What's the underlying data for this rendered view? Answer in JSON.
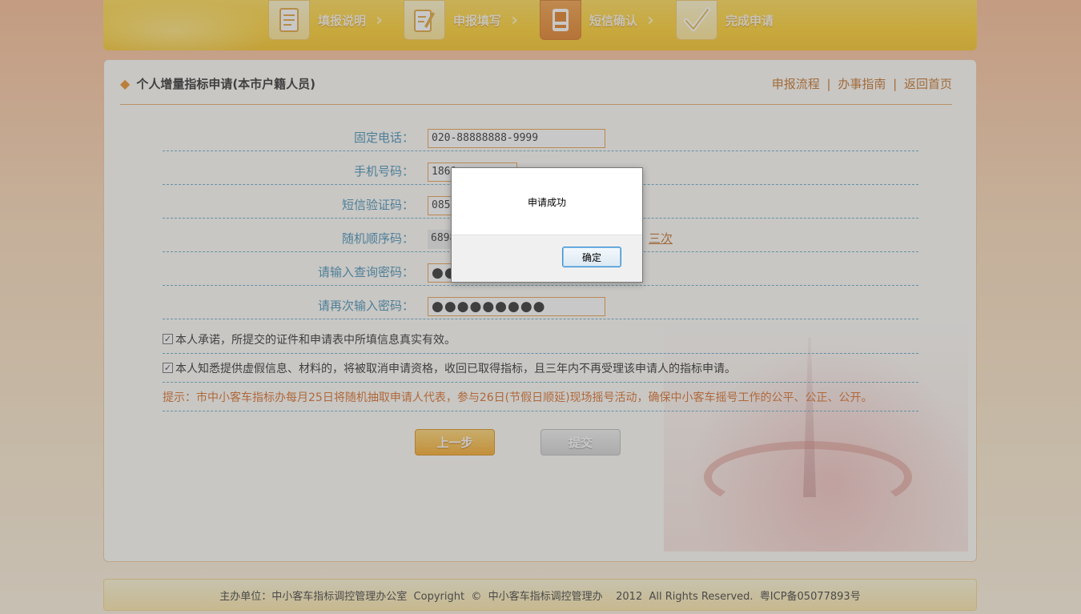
{
  "steps": [
    {
      "label": "填报说明",
      "icon": "document-icon"
    },
    {
      "label": "申报填写",
      "icon": "edit-icon"
    },
    {
      "label": "短信确认",
      "icon": "phone-icon"
    },
    {
      "label": "完成申请",
      "icon": "checkmark-icon"
    }
  ],
  "header": {
    "title": "个人增量指标申请(本市户籍人员)",
    "links": [
      "申报流程",
      "办事指南",
      "返回首页"
    ],
    "separator": "|"
  },
  "form": {
    "landline_label": "固定电话：",
    "landline_value": "020-88888888-9999",
    "mobile_label": "手机号码：",
    "mobile_value": "1860",
    "sms_code_label": "短信验证码：",
    "sms_code_value": "0858",
    "random_seq_label": "随机顺序码：",
    "random_seq_value": "6898",
    "resend_text": "三次",
    "password_label": "请输入查询密码：",
    "password_value": "●●",
    "password_confirm_label": "请再次输入密码：",
    "password_confirm_value": "●●●●●●●●●"
  },
  "checks": {
    "pledge_mark": "✓",
    "pledge_text": "本人承诺，所提交的证件和申请表中所填信息真实有效。",
    "aware_mark": "✓",
    "aware_text": "本人知悉提供虚假信息、材料的，将被取消申请资格，收回已取得指标，且三年内不再受理该申请人的指标申请。"
  },
  "hint": "提示：市中小客车指标办每月25日将随机抽取申请人代表，参与26日(节假日顺延)现场摇号活动，确保中小客车摇号工作的公平、公正、公开。",
  "buttons": {
    "prev": "上一步",
    "submit": "提交"
  },
  "footer": "主办单位：中小客车指标调控管理办公室  Copyright  ©  中小客车指标调控管理办    2012  All Rights Reserved.  粤ICP备05077893号",
  "dialog": {
    "message": "申请成功",
    "ok": "确定"
  },
  "colors": {
    "accent": "#c2691a",
    "label": "#3a89b0",
    "hint": "#d9651a"
  }
}
